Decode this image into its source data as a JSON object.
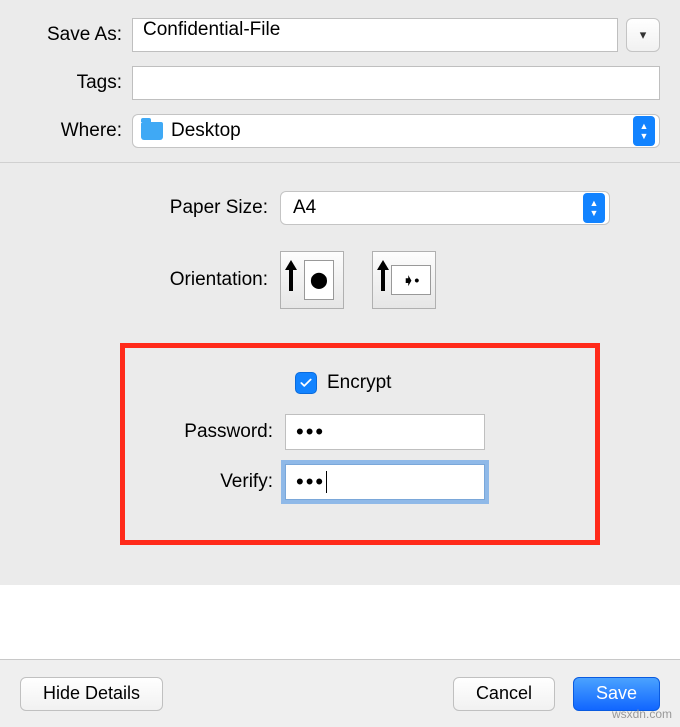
{
  "top": {
    "save_as_label": "Save As:",
    "save_as_value": "Confidential-File",
    "tags_label": "Tags:",
    "tags_value": "",
    "where_label": "Where:",
    "where_value": "Desktop"
  },
  "mid": {
    "paper_size_label": "Paper Size:",
    "paper_size_value": "A4",
    "orientation_label": "Orientation:"
  },
  "encrypt": {
    "checkbox_label": "Encrypt",
    "checked": true,
    "password_label": "Password:",
    "password_value": "•••",
    "verify_label": "Verify:",
    "verify_value": "•••"
  },
  "buttons": {
    "hide_details": "Hide Details",
    "cancel": "Cancel",
    "save": "Save"
  },
  "watermark": "wsxdn.com"
}
